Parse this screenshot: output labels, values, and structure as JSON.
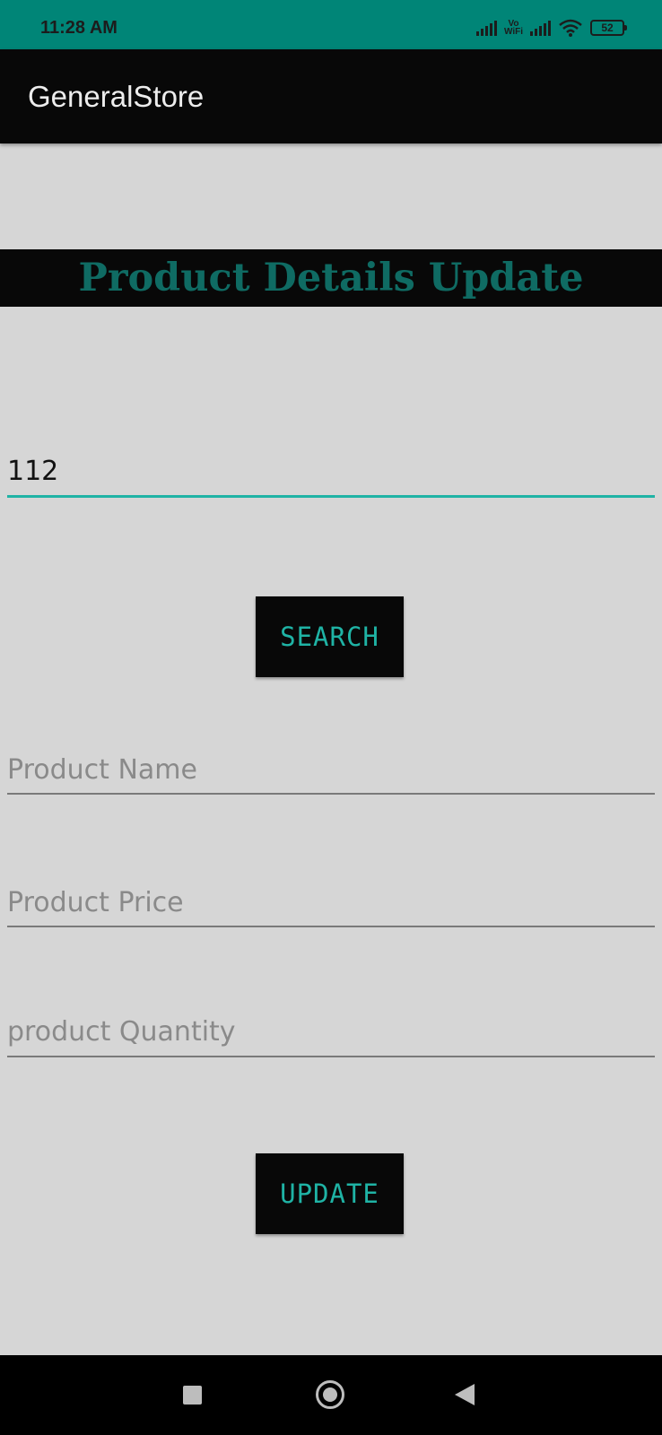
{
  "status_bar": {
    "time": "11:28 AM",
    "network_label_top": "Vo",
    "network_label_bottom": "WiFi",
    "battery": "52",
    "icons": [
      "signal-icon",
      "vowifi-icon",
      "signal-icon",
      "wifi-icon",
      "battery-icon"
    ]
  },
  "app_bar": {
    "title": "GeneralStore"
  },
  "header": {
    "title": "Product Details Update"
  },
  "form": {
    "product_id_value": "112",
    "search_label": "SEARCH",
    "name_placeholder": "Product Name",
    "price_placeholder": "Product Price",
    "quantity_placeholder": "product Quantity",
    "update_label": "UPDATE"
  },
  "nav_bar": {
    "icons": [
      "recents-icon",
      "home-icon",
      "back-icon"
    ]
  },
  "colors": {
    "status_bar": "#008577",
    "app_bar": "#080808",
    "background": "#d6d6d6",
    "accent": "#1fb3a5",
    "header_text": "#0f6b63"
  }
}
